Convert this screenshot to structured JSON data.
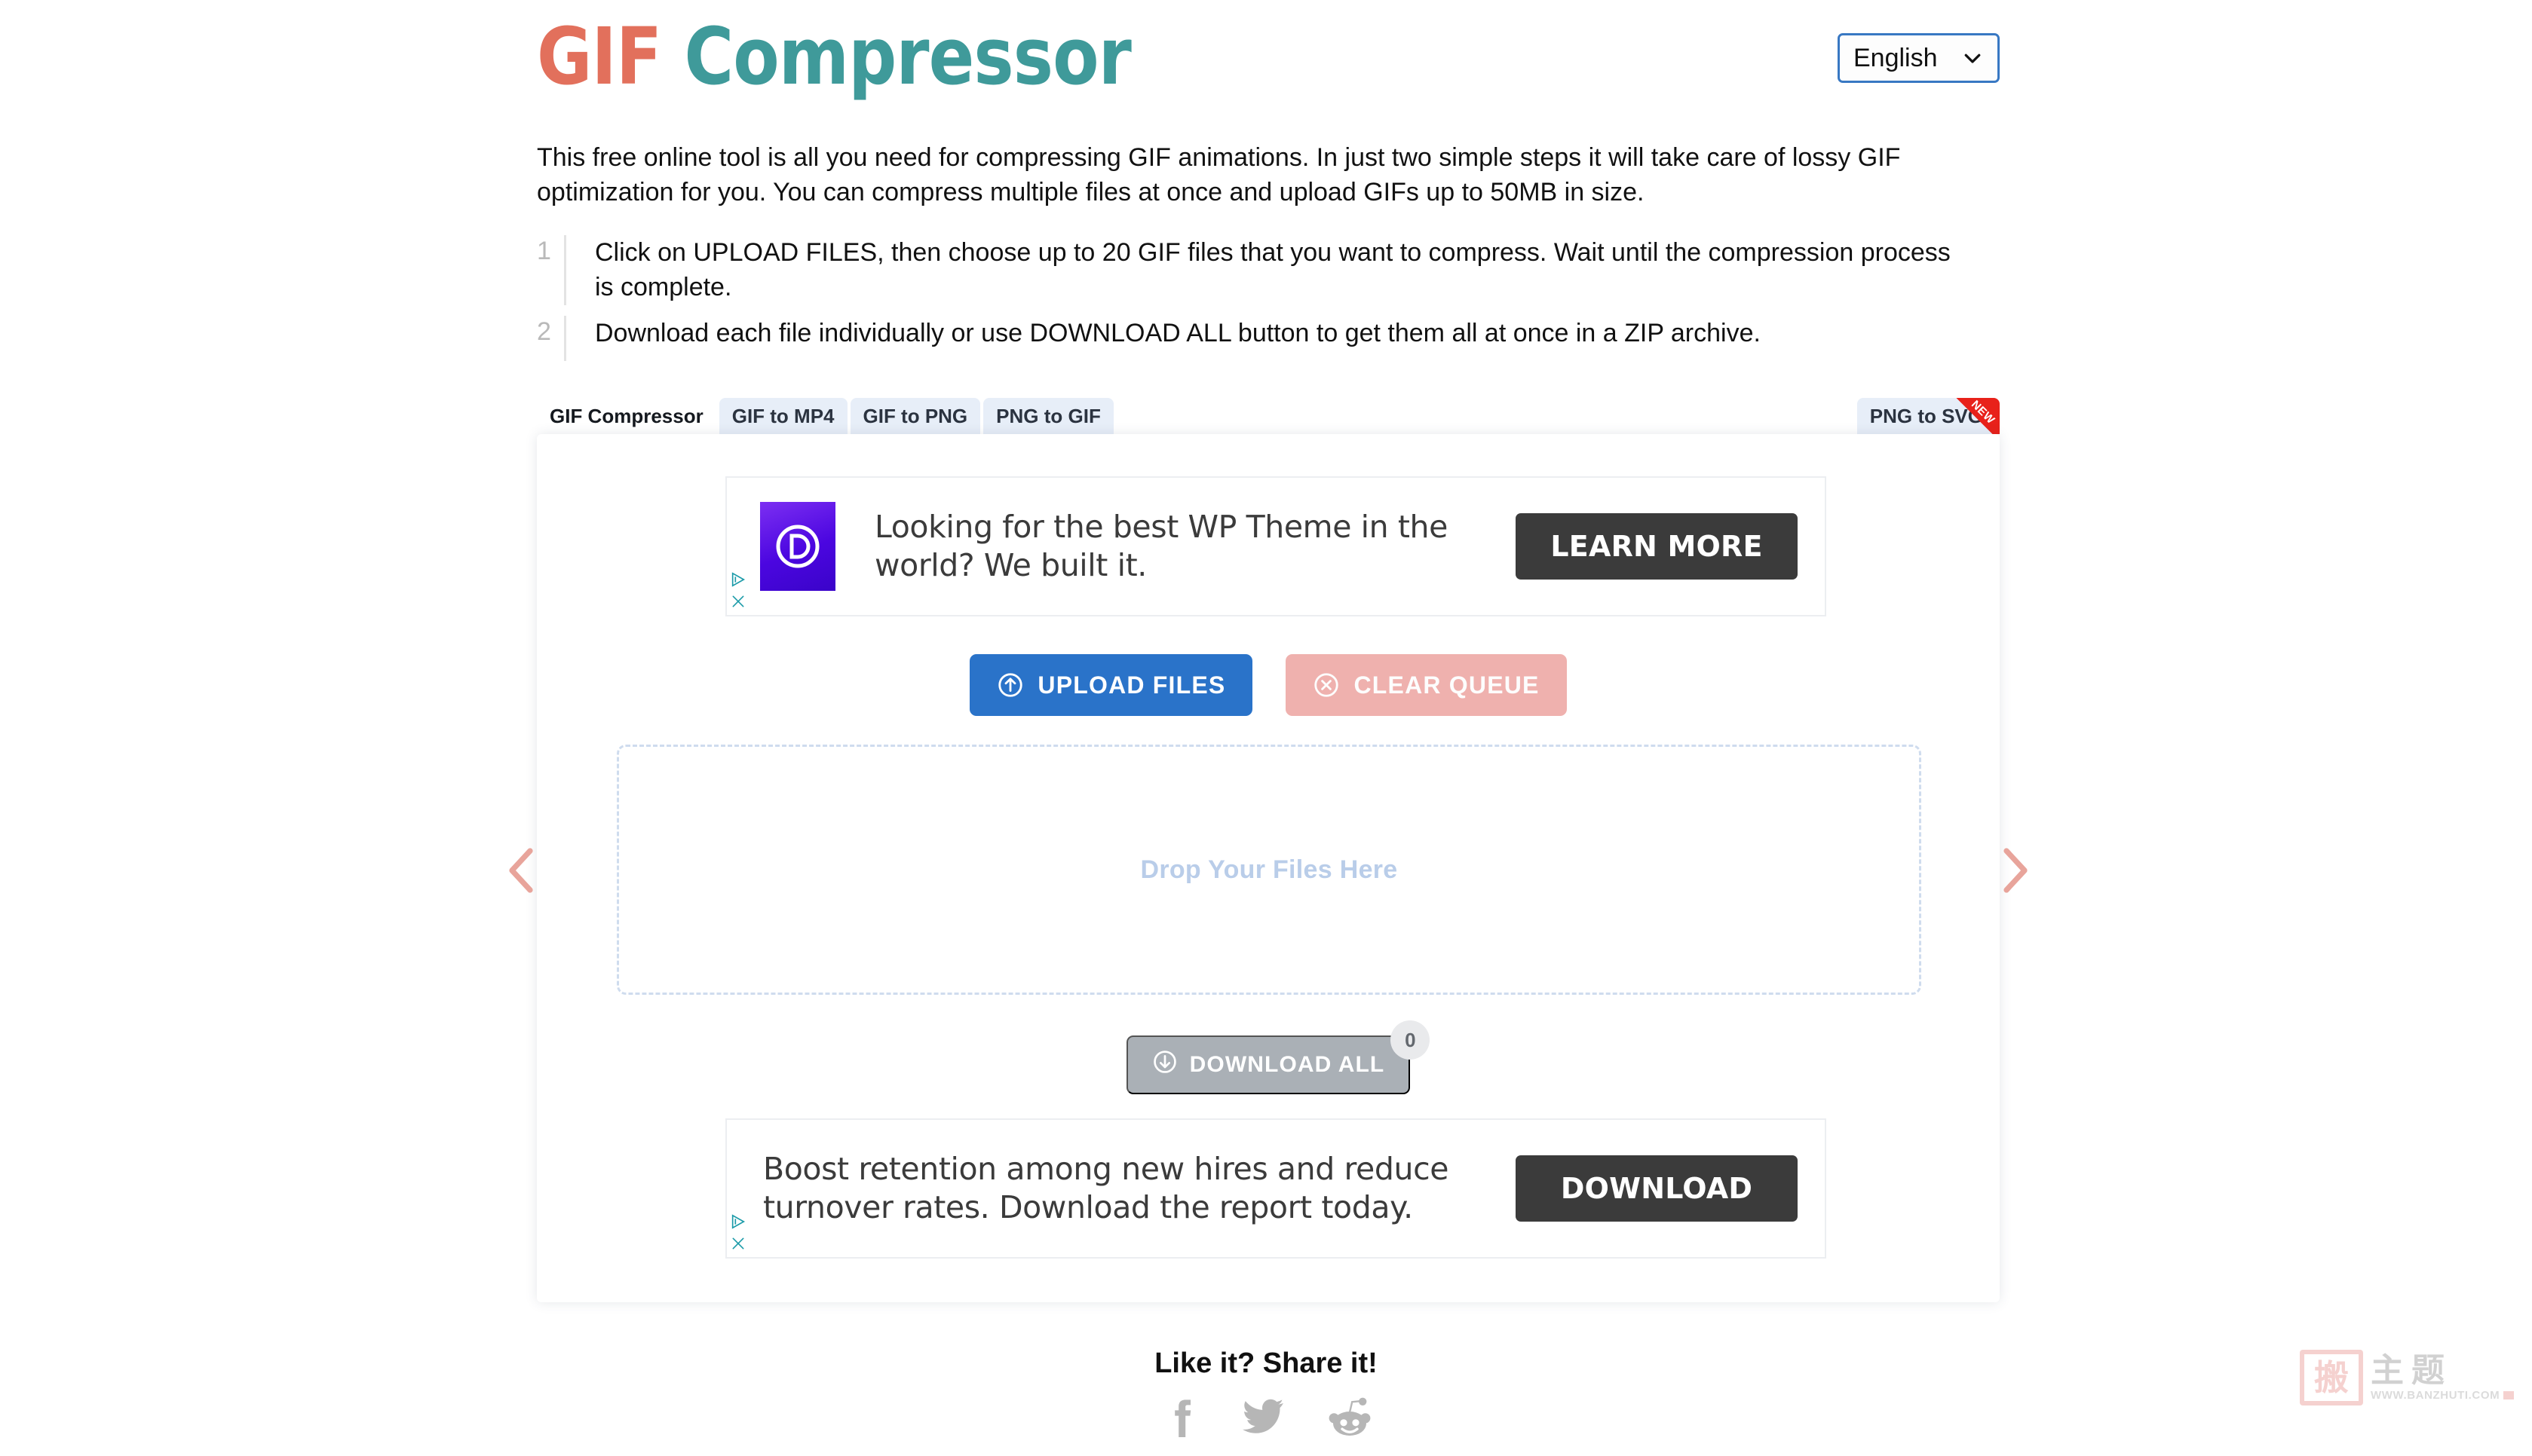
{
  "header": {
    "logo_gif": "GIF",
    "logo_compressor": " Compressor",
    "logo_color_gif": "#e2705c",
    "logo_color_compressor": "#3f9a9a",
    "language": {
      "selected": "English",
      "icon": "chevron-down-icon"
    }
  },
  "intro": {
    "paragraph": "This free online tool is all you need for compressing GIF animations. In just two simple steps it will take care of lossy GIF optimization for you. You can compress multiple files at once and upload GIFs up to 50MB in size."
  },
  "steps": [
    {
      "number": "1",
      "text": "Click on UPLOAD FILES, then choose up to 20 GIF files that you want to compress. Wait until the compression process is complete."
    },
    {
      "number": "2",
      "text": "Download each file individually or use DOWNLOAD ALL button to get them all at once in a ZIP archive."
    }
  ],
  "tabs": {
    "left": [
      {
        "label": "GIF Compressor",
        "active": true
      },
      {
        "label": "GIF to MP4",
        "active": false
      },
      {
        "label": "GIF to PNG",
        "active": false
      },
      {
        "label": "PNG to GIF",
        "active": false
      }
    ],
    "right": {
      "label": "PNG to SVG",
      "ribbon": "NEW",
      "ribbon_color": "#e8211a"
    }
  },
  "ads": {
    "top": {
      "logo_letter": "D",
      "headline": "Looking for the best WP Theme in the world? We built it.",
      "cta": "LEARN MORE",
      "adchoices_icon": "adchoices-triangle-icon",
      "close_icon": "close-icon"
    },
    "bottom": {
      "headline": "Boost retention among new hires and reduce turnover rates. Download the report today.",
      "cta": "DOWNLOAD",
      "adchoices_icon": "adchoices-triangle-icon",
      "close_icon": "close-icon"
    }
  },
  "actions": {
    "upload_label": "UPLOAD FILES",
    "upload_icon": "arrow-up-circle-icon",
    "upload_color": "#2a73c9",
    "clear_label": "CLEAR QUEUE",
    "clear_icon": "x-circle-icon",
    "clear_color": "#efb1ae"
  },
  "dropzone": {
    "label": "Drop Your Files Here",
    "prev_icon": "chevron-left-icon",
    "next_icon": "chevron-right-icon",
    "arrow_color": "#e8a49b"
  },
  "download_all": {
    "label": "DOWNLOAD ALL",
    "icon": "arrow-down-circle-icon",
    "badge_count": "0",
    "color": "#aab0b6"
  },
  "share": {
    "title": "Like it? Share it!",
    "links": [
      {
        "name": "facebook-icon"
      },
      {
        "name": "twitter-icon"
      },
      {
        "name": "reddit-icon"
      }
    ]
  },
  "watermark": {
    "seal": "搬",
    "chinese": "主题",
    "url": "WWW.BANZHUTI.COM"
  }
}
